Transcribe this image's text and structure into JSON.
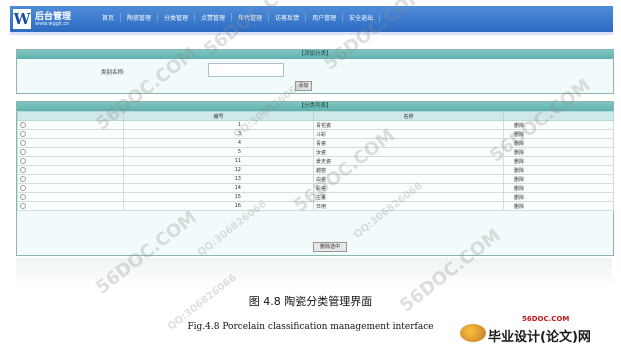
{
  "header": {
    "logo_mark": "W",
    "logo_title": "后台管理",
    "logo_sub": "www.wggk.cn",
    "nav": [
      "首页",
      "陶瓷管理",
      "分类管理",
      "点赞管理",
      "年代管理",
      "访客反馈",
      "用户管理",
      "安全退出"
    ]
  },
  "add_panel": {
    "title": "【添加分类】",
    "label": "类别名称:",
    "input_value": "",
    "button": "添加"
  },
  "list_panel": {
    "title": "【分类列表】",
    "columns": [
      "",
      "编号",
      "名称",
      ""
    ],
    "rows": [
      {
        "id": "1",
        "name": "青花瓷",
        "op": "删除"
      },
      {
        "id": "3",
        "name": "斗彩",
        "op": "删除"
      },
      {
        "id": "4",
        "name": "青瓷",
        "op": "删除"
      },
      {
        "id": "5",
        "name": "汝瓷",
        "op": "删除"
      },
      {
        "id": "11",
        "name": "景天瓷",
        "op": "删除"
      },
      {
        "id": "12",
        "name": "越窑",
        "op": "删除"
      },
      {
        "id": "13",
        "name": "白瓷",
        "op": "删除"
      },
      {
        "id": "14",
        "name": "彩瓷",
        "op": "删除"
      },
      {
        "id": "15",
        "name": "古董",
        "op": "删除"
      },
      {
        "id": "16",
        "name": "日用",
        "op": "删除"
      }
    ],
    "delete_selected": "删除选中"
  },
  "caption": {
    "cn": "图 4.8 陶瓷分类管理界面",
    "en": "Fig.4.8 Porcelain classification management interface"
  },
  "watermarks": [
    "56DOC.COM",
    "QQ:306826066"
  ],
  "brand": {
    "url": "56DOC.COM",
    "text": "毕业设计(论文)网"
  }
}
